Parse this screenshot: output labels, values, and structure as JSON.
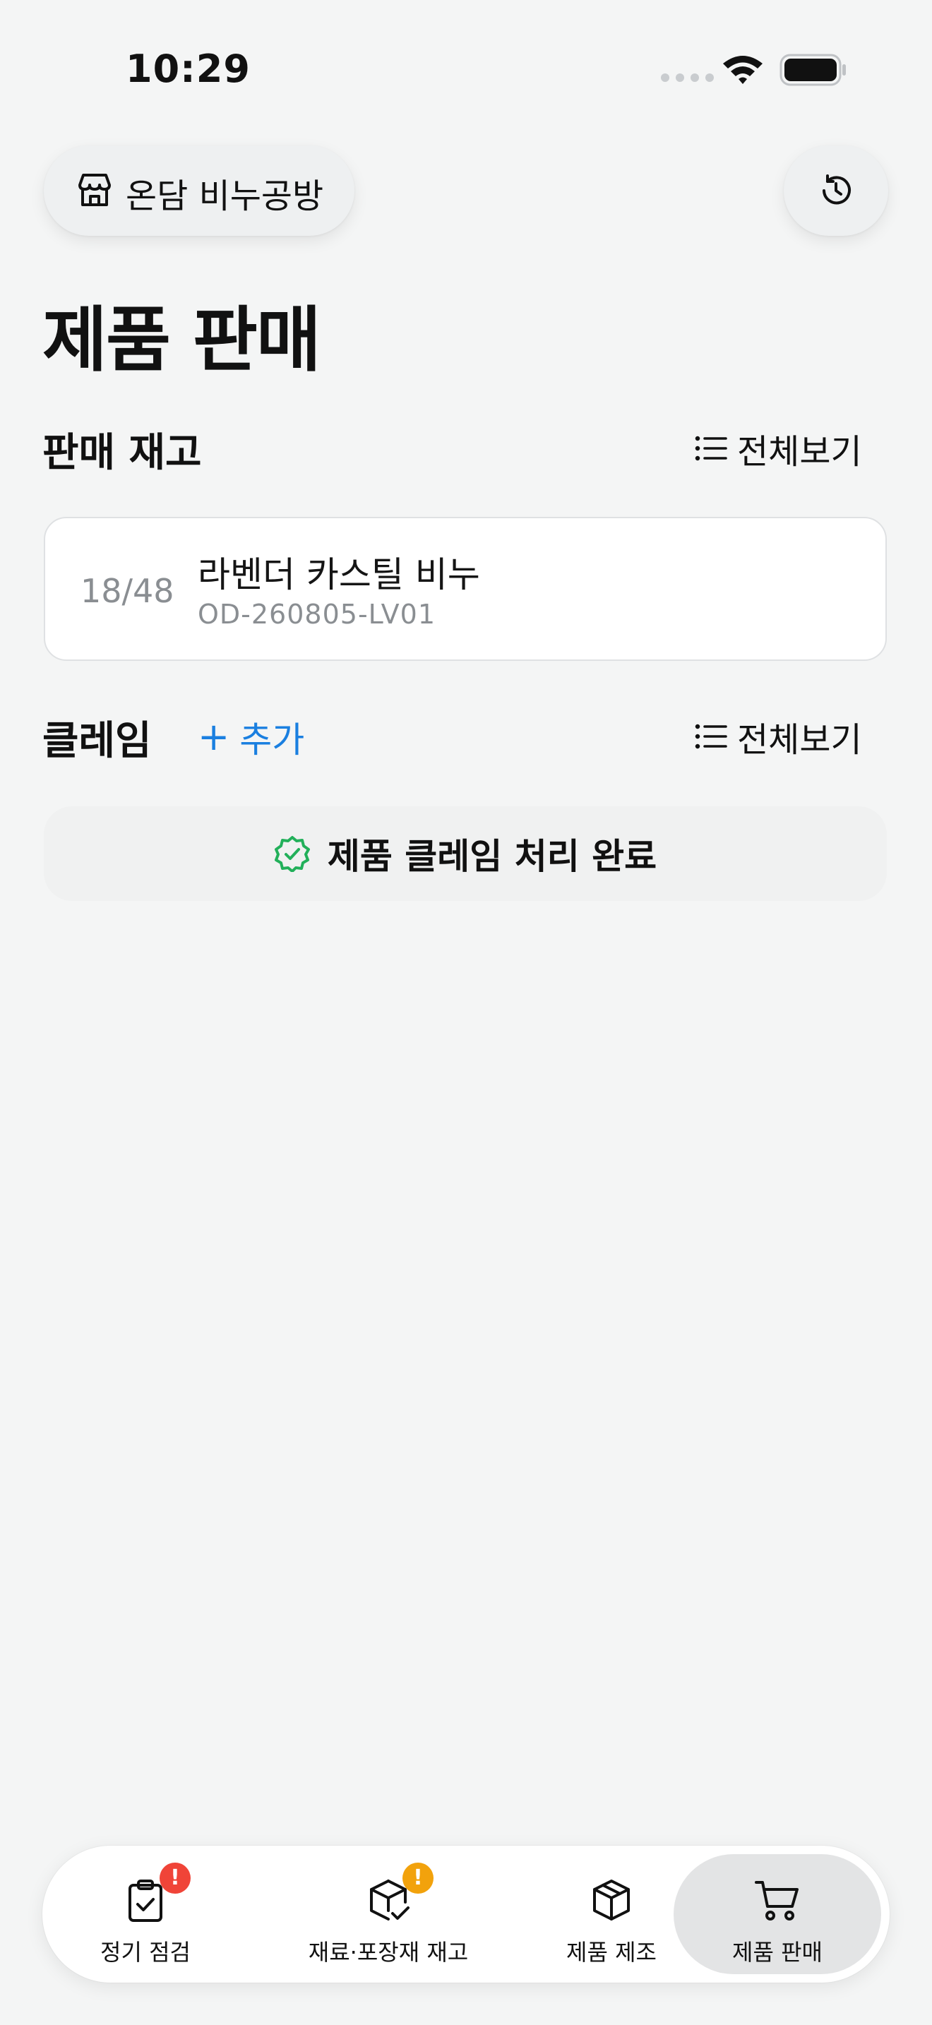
{
  "status_bar": {
    "time": "10:29"
  },
  "header": {
    "store_name": "온담 비누공방"
  },
  "page": {
    "title": "제품 판매"
  },
  "inventory_section": {
    "title": "판매 재고",
    "view_all_label": "전체보기",
    "items": [
      {
        "count": "18/48",
        "name": "라벤더 카스틸 비누",
        "code": "OD-260805-LV01"
      }
    ]
  },
  "claim_section": {
    "title": "클레임",
    "add_label": "추가",
    "view_all_label": "전체보기",
    "status_text": "제품 클레임 처리 완료"
  },
  "tab_bar": {
    "tabs": [
      {
        "label": "정기 점검",
        "badge": "!",
        "badge_color": "#f04438",
        "active": false
      },
      {
        "label": "재료·포장재 재고",
        "badge": "!",
        "badge_color": "#f2a20c",
        "active": false
      },
      {
        "label": "제품 제조",
        "badge": "",
        "active": false
      },
      {
        "label": "제품 판매",
        "badge": "",
        "active": true
      }
    ]
  },
  "colors": {
    "accent_blue": "#1a7fe0",
    "success_green": "#22b05a",
    "background": "#f4f5f5"
  }
}
